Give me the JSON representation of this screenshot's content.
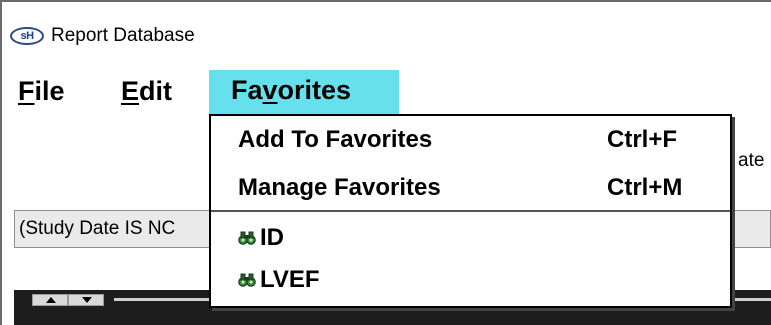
{
  "window": {
    "icon_text": "sH",
    "title": "Report Database"
  },
  "menubar": {
    "file_prefix": "",
    "file_hotkey": "F",
    "file_rest": "ile",
    "edit_hotkey": "E",
    "edit_rest": "dit",
    "favorites_pre": "Fa",
    "favorites_hotkey": "v",
    "favorites_post": "orites"
  },
  "background": {
    "partial_label": "ate",
    "query_text": "(Study Date IS NC"
  },
  "favorites_menu": {
    "add_label": "Add To Favorites",
    "add_shortcut": "Ctrl+F",
    "manage_label": "Manage Favorites",
    "manage_shortcut": "Ctrl+M",
    "items": [
      {
        "label": "ID",
        "icon": "binoculars-icon"
      },
      {
        "label": "LVEF",
        "icon": "binoculars-icon"
      }
    ]
  },
  "colors": {
    "menu_highlight": "#66e0ec",
    "dark_strip": "#1d1d1d"
  }
}
